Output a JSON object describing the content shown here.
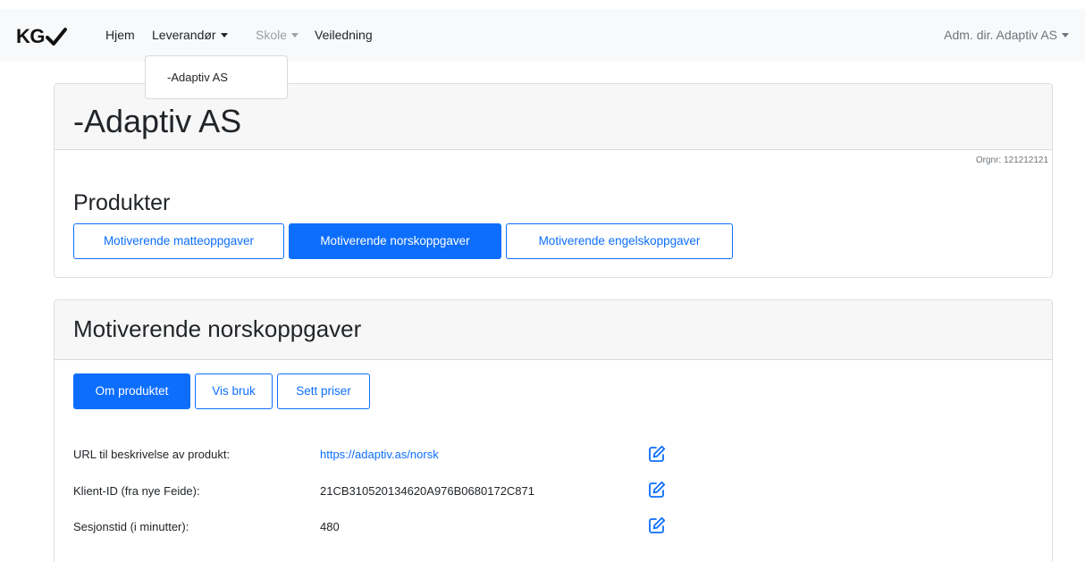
{
  "navbar": {
    "brand": "KG",
    "items": [
      {
        "label": "Hjem"
      },
      {
        "label": "Leverandør"
      },
      {
        "label": "Skole"
      },
      {
        "label": "Veiledning"
      }
    ],
    "user_menu": "Adm. dir. Adaptiv AS"
  },
  "dropdown": {
    "items": [
      "-Adaptiv AS"
    ]
  },
  "supplier": {
    "title": "-Adaptiv AS",
    "orgnr": "Orgnr: 121212121",
    "products_heading": "Produkter",
    "products": [
      {
        "label": "Motiverende matteoppgaver",
        "active": false
      },
      {
        "label": "Motiverende norskoppgaver",
        "active": true
      },
      {
        "label": "Motiverende engelskoppgaver",
        "active": false
      }
    ]
  },
  "product": {
    "title": "Motiverende norskoppgaver",
    "tabs": [
      {
        "label": "Om produktet",
        "active": true
      },
      {
        "label": "Vis bruk",
        "active": false
      },
      {
        "label": "Sett priser",
        "active": false
      }
    ],
    "fields": [
      {
        "label": "URL til beskrivelse av produkt:",
        "value": "https://adaptiv.as/norsk"
      },
      {
        "label": "Klient-ID (fra nye Feide):",
        "value": "21CB310520134620A976B0680172C871"
      },
      {
        "label": "Sesjonstid (i minutter):",
        "value": "480"
      }
    ]
  },
  "colors": {
    "primary": "#0d6efd",
    "navbar_bg": "#f8f9fa",
    "card_header_bg": "#f7f7f7"
  },
  "icons": {
    "brand": "checkmark-icon",
    "dropdown": "caret-down-icon",
    "edit": "edit-icon"
  }
}
